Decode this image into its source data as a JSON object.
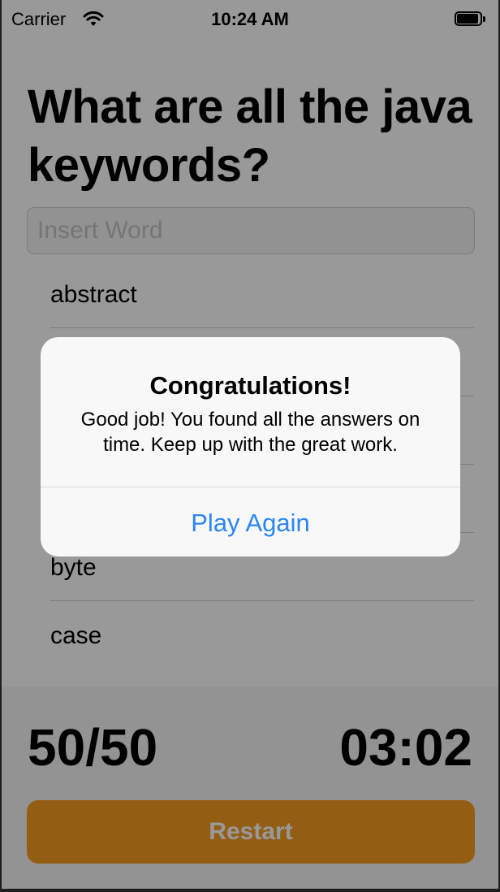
{
  "status_bar": {
    "carrier": "Carrier",
    "time": "10:24 AM",
    "wifi_icon": "wifi-icon",
    "battery_icon": "battery-icon"
  },
  "question": "What are all the java keywords?",
  "word_input": {
    "placeholder": "Insert Word",
    "value": ""
  },
  "answers": [
    "abstract",
    "",
    "",
    "",
    "byte",
    "case"
  ],
  "score": "50/50",
  "timer": "03:02",
  "restart_label": "Restart",
  "alert": {
    "title": "Congratulations!",
    "message": "Good job! You found all the answers on time. Keep up with the great work.",
    "button_label": "Play Again"
  },
  "colors": {
    "accent_orange": "#f79b22",
    "alert_button_blue": "#2a86f4",
    "overlay": "rgba(0,0,0,0.40)"
  }
}
